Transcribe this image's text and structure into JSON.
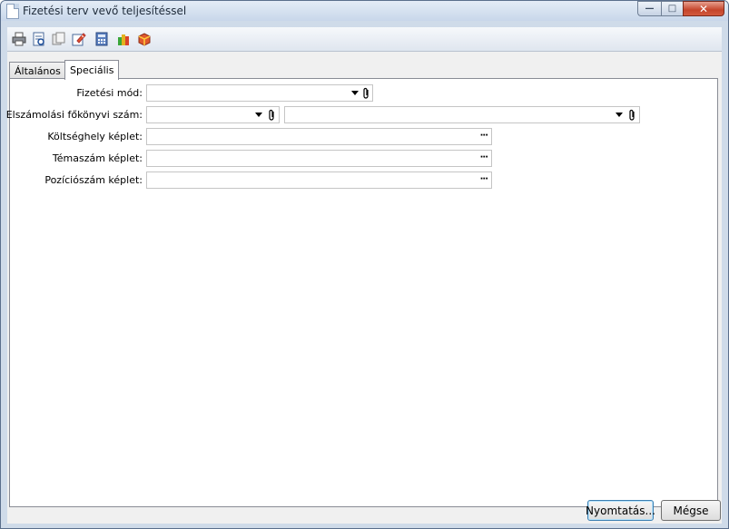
{
  "window": {
    "title": "Fizetési terv vevő teljesítéssel",
    "controls": {
      "minimize": "—",
      "maximize": "□",
      "close": "✕"
    }
  },
  "toolbar": {
    "icons": [
      "printer-icon",
      "print-preview-icon",
      "copy-icon",
      "edit-icon",
      "calculator-icon",
      "stack-icon",
      "package-icon"
    ]
  },
  "tabs": [
    {
      "label": "Általános",
      "active": false
    },
    {
      "label": "Speciális",
      "active": true
    }
  ],
  "form": {
    "fizetesi_mod": {
      "label": "Fizetési mód:",
      "value": ""
    },
    "fokonyvi_szam": {
      "label": "Elszámolási főkönyvi szám:",
      "value": "",
      "value2": ""
    },
    "koltseghely": {
      "label": "Költséghely képlet:",
      "value": ""
    },
    "temaszam": {
      "label": "Témaszám képlet:",
      "value": ""
    },
    "pozicioszam": {
      "label": "Pozíciószám képlet:",
      "value": ""
    },
    "ellipsis": "···"
  },
  "buttons": {
    "print": "Nyomtatás...",
    "cancel": "Mégse"
  }
}
